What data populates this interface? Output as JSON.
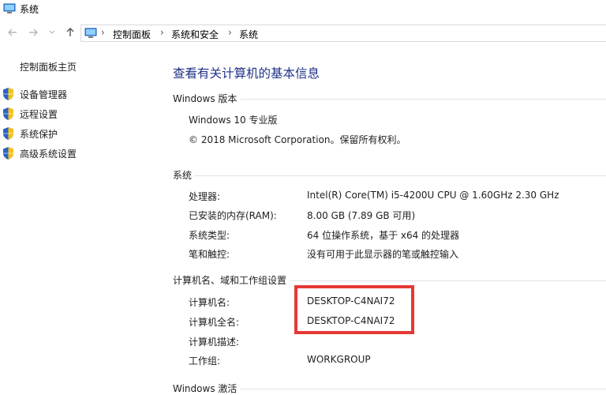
{
  "window": {
    "title": "系统"
  },
  "addressbar": {
    "crumbs": [
      "控制面板",
      "系统和安全",
      "系统"
    ]
  },
  "sidebar": {
    "home": "控制面板主页",
    "items": [
      {
        "label": "设备管理器",
        "icon": "shield-icon"
      },
      {
        "label": "远程设置",
        "icon": "shield-icon"
      },
      {
        "label": "系统保护",
        "icon": "shield-icon"
      },
      {
        "label": "高级系统设置",
        "icon": "shield-icon"
      }
    ]
  },
  "main": {
    "heading": "查看有关计算机的基本信息",
    "windows_edition": {
      "title": "Windows 版本",
      "edition": "Windows 10 专业版",
      "copyright": "© 2018 Microsoft Corporation。保留所有权利。"
    },
    "system": {
      "title": "系统",
      "rows": [
        {
          "label": "处理器:",
          "value": "Intel(R) Core(TM) i5-4200U CPU @ 1.60GHz   2.30 GHz"
        },
        {
          "label": "已安装的内存(RAM):",
          "value": "8.00 GB (7.89 GB 可用)"
        },
        {
          "label": "系统类型:",
          "value": "64 位操作系统，基于 x64 的处理器"
        },
        {
          "label": "笔和触控:",
          "value": "没有可用于此显示器的笔或触控输入"
        }
      ]
    },
    "computer": {
      "title": "计算机名、域和工作组设置",
      "rows": [
        {
          "label": "计算机名:",
          "value": "DESKTOP-C4NAI72"
        },
        {
          "label": "计算机全名:",
          "value": "DESKTOP-C4NAI72"
        },
        {
          "label": "计算机描述:",
          "value": ""
        },
        {
          "label": "工作组:",
          "value": "WORKGROUP"
        }
      ]
    },
    "activation": {
      "title": "Windows 激活"
    }
  },
  "colors": {
    "heading": "#1e3287",
    "highlight": "#e53935",
    "shield_blue": "#2b62c4",
    "shield_yellow": "#f4c21a"
  }
}
